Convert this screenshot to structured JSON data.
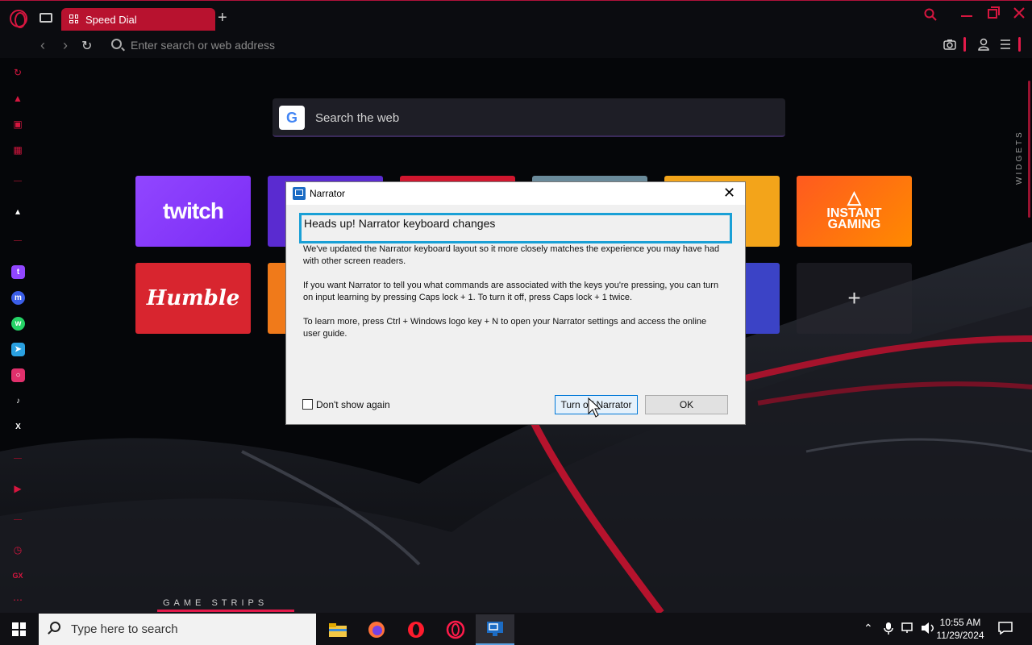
{
  "browser": {
    "tab_title": "Speed Dial",
    "address_placeholder": "Enter search or web address",
    "widgets_label": "WIDGETS",
    "game_strips_label": "GAME STRIPS"
  },
  "search": {
    "provider_icon": "G",
    "placeholder": "Search the web"
  },
  "speed_dial": {
    "tiles": [
      {
        "name": "twitch",
        "label": "twitch"
      },
      {
        "name": "humble",
        "label": "Humble"
      },
      {
        "name": "instant-gaming",
        "label_line1": "INSTANT",
        "label_line2": "GAMING"
      },
      {
        "name": "add",
        "label": "+"
      }
    ]
  },
  "dialog": {
    "title": "Narrator",
    "heading": "Heads up! Narrator keyboard changes",
    "paragraphs": [
      "We've updated the Narrator keyboard layout so it more closely matches the experience you may have had with other screen readers.",
      "If you want Narrator to tell you what commands are associated with the keys you're pressing, you can turn on input learning by pressing Caps lock + 1. To turn it off, press Caps lock + 1 twice.",
      "To learn more, press Ctrl + Windows logo key + N to open your Narrator settings and access the online user guide."
    ],
    "checkbox_label": "Don't show again",
    "turn_off_button": "Turn off Narrator",
    "ok_button": "OK"
  },
  "taskbar": {
    "search_placeholder": "Type here to search",
    "time": "10:55 AM",
    "date": "11/29/2024"
  },
  "colors": {
    "accent": "#d6163f",
    "dialog_heading_border": "#1aa0d6"
  }
}
